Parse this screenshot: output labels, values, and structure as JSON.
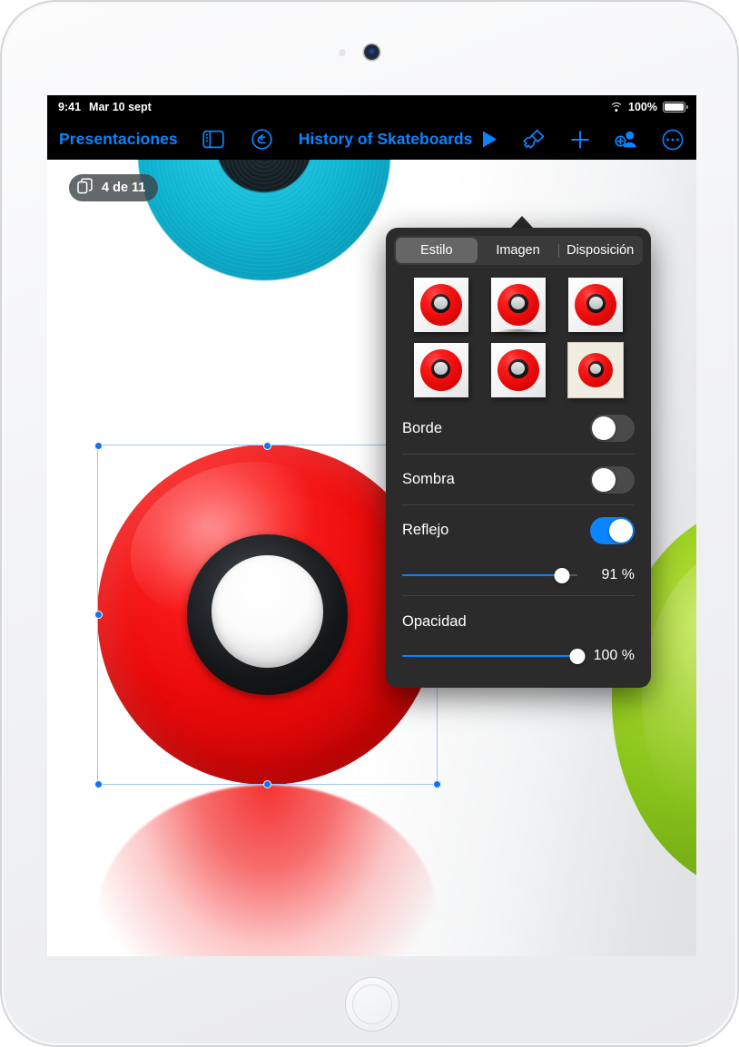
{
  "status_bar": {
    "time": "9:41",
    "date": "Mar 10 sept",
    "wifi_icon": "wifi-icon",
    "battery_percent": "100%",
    "battery_icon": "battery-full-icon"
  },
  "toolbar": {
    "back_label": "Presentaciones",
    "sidebar_icon": "sidebar-navigator-icon",
    "undo_icon": "undo-arrow-icon",
    "document_title": "History of Skateboards",
    "play_icon": "play-triangle-icon",
    "format_icon": "paintbrush-format-icon",
    "add_icon": "plus-icon",
    "collaborate_icon": "add-person-icon",
    "more_icon": "ellipsis-circle-icon"
  },
  "canvas": {
    "slide_counter": {
      "icon": "duplicate-slides-icon",
      "label": "4 de 11"
    },
    "selected_object": "red-skateboard-wheel-image"
  },
  "format_popover": {
    "tabs": [
      {
        "label": "Estilo",
        "active": true
      },
      {
        "label": "Imagen",
        "active": false
      },
      {
        "label": "Disposición",
        "active": false
      }
    ],
    "style_thumbnails": [
      {
        "name": "style-plain",
        "selected": false,
        "framed": false
      },
      {
        "name": "style-shadow",
        "selected": false,
        "framed": false
      },
      {
        "name": "style-border-thin",
        "selected": false,
        "framed": false
      },
      {
        "name": "style-soft",
        "selected": false,
        "framed": false
      },
      {
        "name": "style-reflection",
        "selected": false,
        "framed": false
      },
      {
        "name": "style-mat-frame",
        "selected": true,
        "framed": true
      }
    ],
    "rows": [
      {
        "label": "Borde",
        "toggle": "off"
      },
      {
        "label": "Sombra",
        "toggle": "off"
      },
      {
        "label": "Reflejo",
        "toggle": "on"
      }
    ],
    "reflection": {
      "label": "Reflejo",
      "value": "91 %",
      "percent": 91
    },
    "opacity": {
      "label": "Opacidad",
      "value": "100 %",
      "percent": 100
    }
  },
  "colors": {
    "accent_blue": "#0a84ff",
    "panel_bg": "#2b2b2b",
    "selection_blue": "#1471f0",
    "wheel_red": "#ee0d0d",
    "wheel_green": "#9ed226",
    "wheel_teal": "#1cc3dd"
  }
}
